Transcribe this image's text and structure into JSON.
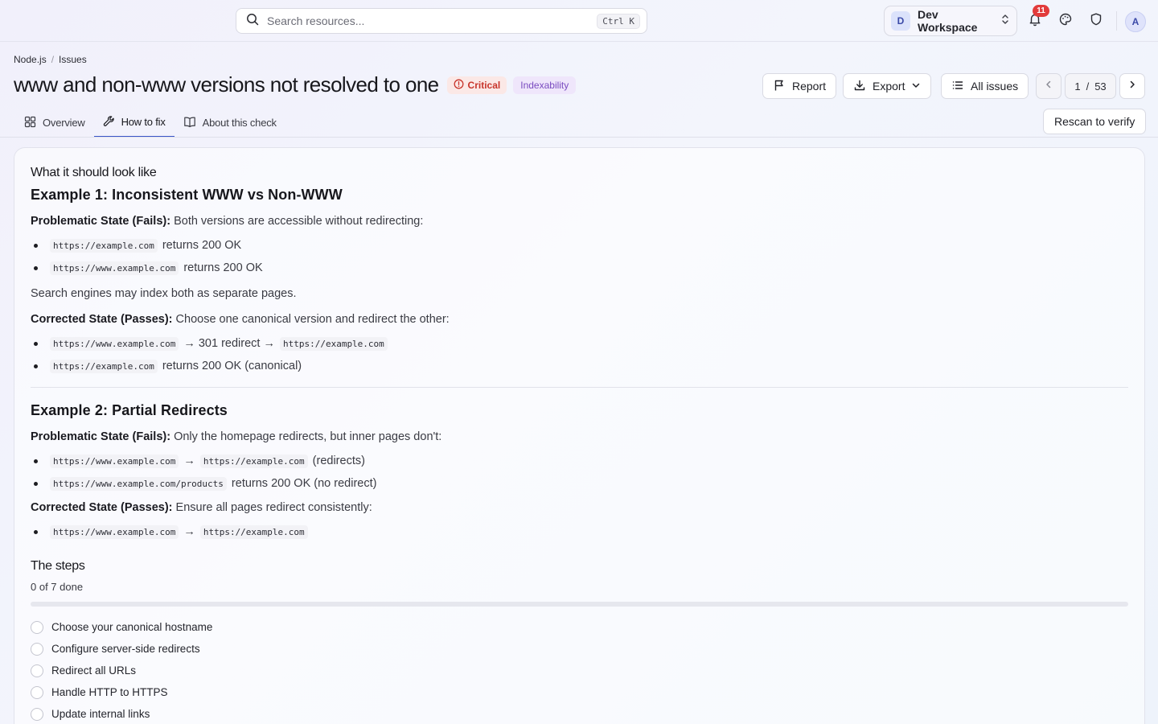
{
  "search": {
    "placeholder": "Search resources...",
    "shortcut": "Ctrl K"
  },
  "workspace": {
    "initial": "D",
    "name": "Dev Workspace"
  },
  "notifications": {
    "count": "11"
  },
  "user": {
    "initial": "A"
  },
  "breadcrumb": [
    "Node.js",
    "Issues"
  ],
  "issue": {
    "title": "www and non-www versions not resolved to one",
    "severity": "Critical",
    "category": "Indexability"
  },
  "actions": {
    "report": "Report",
    "export": "Export",
    "all_issues": "All issues",
    "rescan": "Rescan to verify"
  },
  "pager": {
    "current": "1",
    "separator": "/",
    "total": "53"
  },
  "tabs": [
    {
      "label": "Overview",
      "icon": "grid-icon"
    },
    {
      "label": "How to fix",
      "icon": "wrench-icon",
      "active": true
    },
    {
      "label": "About this check",
      "icon": "book-icon"
    }
  ],
  "content": {
    "heading": "What it should look like",
    "ex1": {
      "title": "Example 1: Inconsistent WWW vs Non-WWW",
      "bad_label": "Problematic State (Fails):",
      "bad_text": "Both versions are accessible without redirecting:",
      "bad_items": [
        {
          "code": "https://example.com",
          "text": "returns 200 OK"
        },
        {
          "code": "https://www.example.com",
          "text": "returns 200 OK"
        }
      ],
      "note": "Search engines may index both as separate pages.",
      "good_label": "Corrected State (Passes):",
      "good_text": "Choose one canonical version and redirect the other:",
      "good_item1": {
        "code1": "https://www.example.com",
        "text": "→ 301 redirect →",
        "code2": "https://example.com"
      },
      "good_item2": {
        "code": "https://example.com",
        "text": "returns 200 OK (canonical)"
      }
    },
    "ex2": {
      "title": "Example 2: Partial Redirects",
      "bad_label": "Problematic State (Fails):",
      "bad_text": "Only the homepage redirects, but inner pages don't:",
      "bad_item1": {
        "code1": "https://www.example.com",
        "arrow": "→",
        "code2": "https://example.com",
        "text": "(redirects)"
      },
      "bad_item2": {
        "code": "https://www.example.com/products",
        "text": "returns 200 OK (no redirect)"
      },
      "good_label": "Corrected State (Passes):",
      "good_text": "Ensure all pages redirect consistently:",
      "good_item": {
        "code1": "https://www.example.com",
        "arrow": "→",
        "code2": "https://example.com"
      }
    }
  },
  "steps": {
    "heading": "The steps",
    "progress_text": "0 of 7 done",
    "done": 0,
    "total": 7,
    "items": [
      "Choose your canonical hostname",
      "Configure server-side redirects",
      "Redirect all URLs",
      "Handle HTTP to HTTPS",
      "Update internal links"
    ]
  },
  "colors": {
    "accent": "#3a55c8",
    "critical": "#c8352c",
    "tag": "#7a4bc0",
    "badge": "#e23b3b"
  }
}
